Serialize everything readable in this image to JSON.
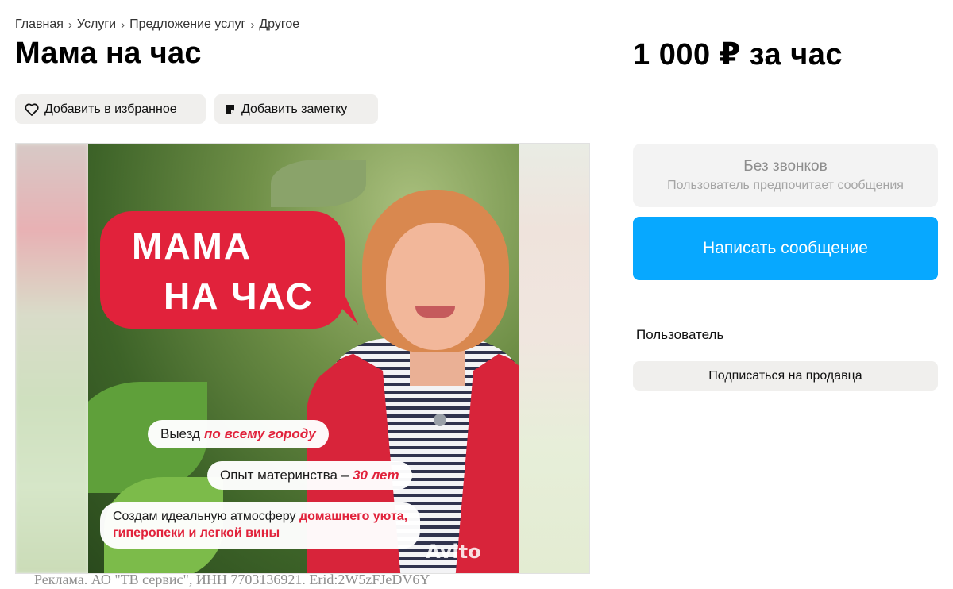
{
  "breadcrumb": [
    "Главная",
    "Услуги",
    "Предложение услуг",
    "Другое"
  ],
  "breadcrumb_separator": "›",
  "title": "Мама на час",
  "price": "1 000 ₽ за час",
  "actions": {
    "favorite_label": "Добавить в избранное",
    "note_label": "Добавить заметку"
  },
  "gallery": {
    "bubble_line1": "МАМА",
    "bubble_line2": "НА ЧАС",
    "tag1_text": "Выезд",
    "tag1_highlight": "по всему городу",
    "tag2_text": "Опыт материнства –",
    "tag2_highlight": "30 лет",
    "tag3_text": "Создам идеальную атмосферу",
    "tag3_highlight": "домашнего уюта,",
    "tag3_line2": "гиперопеки и легкой вины",
    "watermark": "Avito"
  },
  "ad_disclaimer": "Реклама. АО \"ТВ сервис\", ИНН 7703136921. Erid:2W5zFJeDV6Y",
  "contact": {
    "no_calls_title": "Без звонков",
    "no_calls_subtitle": "Пользователь предпочитает сообщения",
    "write_button": "Написать сообщение"
  },
  "seller": {
    "name": "Пользователь",
    "subscribe_button": "Подписаться на продавца"
  },
  "colors": {
    "accent_blue": "#07a8ff",
    "promo_red": "#e1223b",
    "button_gray": "#f0efed"
  },
  "icons": [
    "heart-icon",
    "note-icon"
  ]
}
